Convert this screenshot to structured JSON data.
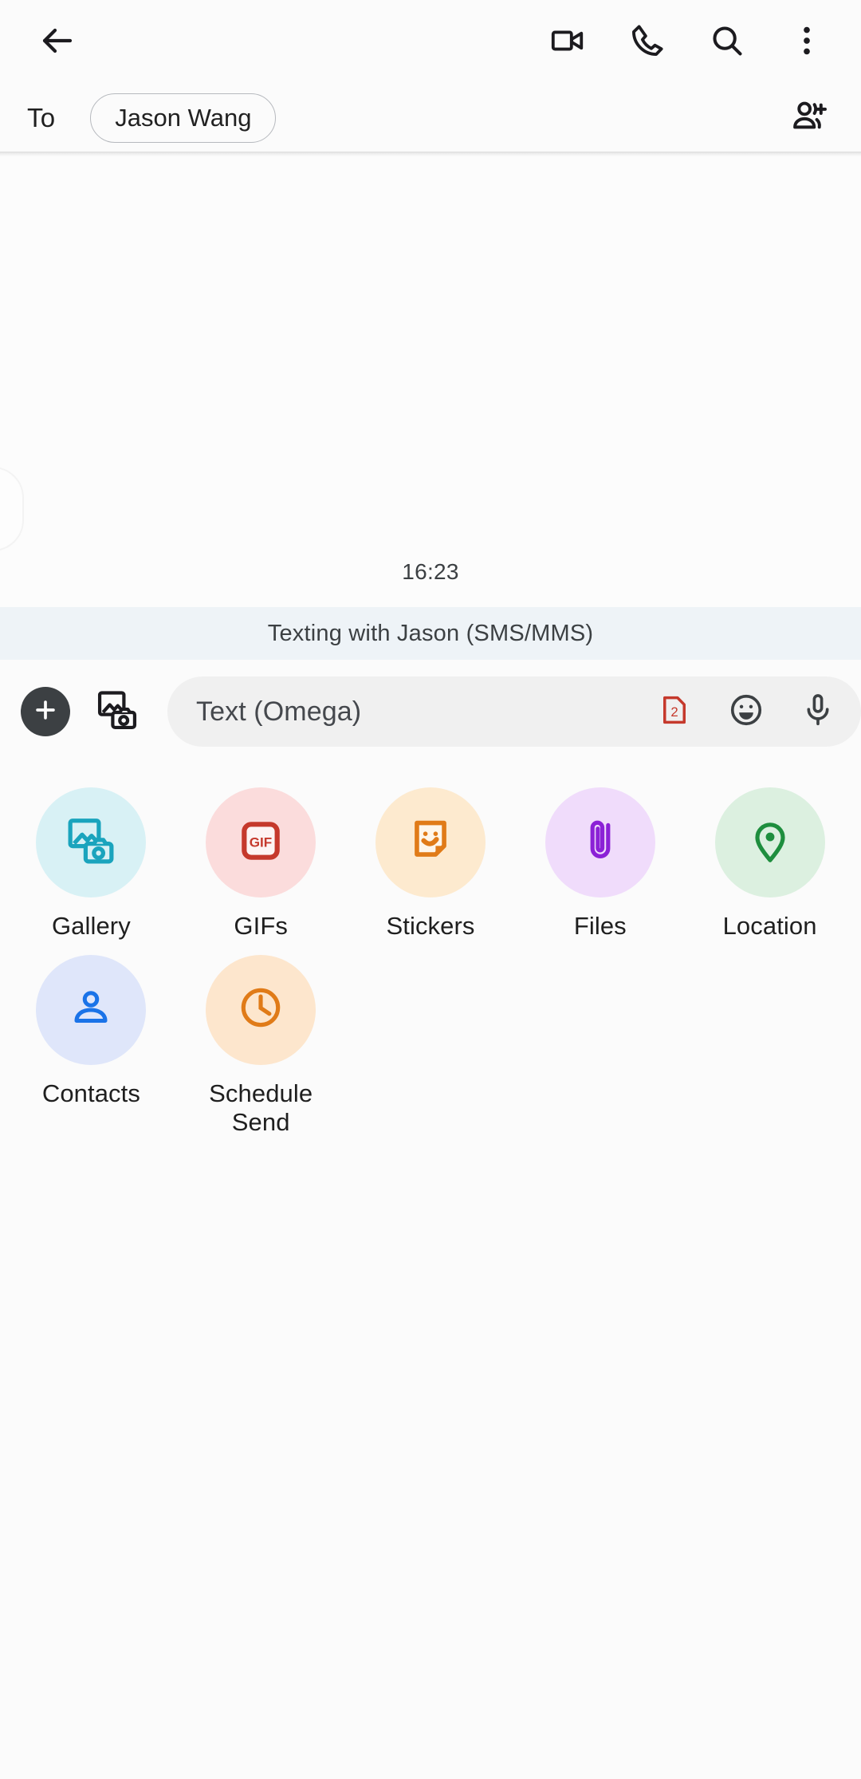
{
  "appbar": {
    "back_icon": "back-arrow-icon",
    "actions": [
      {
        "name": "video-call-button",
        "icon": "video-camera-icon",
        "label": "Video call"
      },
      {
        "name": "voice-call-button",
        "icon": "phone-icon",
        "label": "Call"
      },
      {
        "name": "search-button",
        "icon": "search-icon",
        "label": "Search"
      },
      {
        "name": "overflow-menu-button",
        "icon": "three-dot-menu-icon",
        "label": "More options"
      }
    ]
  },
  "recipient": {
    "to_label": "To",
    "chips": [
      {
        "name": "Jason Wang"
      }
    ],
    "add_person_icon": "person-add-icon",
    "add_person_label": "Add people"
  },
  "conversation": {
    "timestamp": "16:23"
  },
  "banner": {
    "text": "Texting with Jason (SMS/MMS)",
    "background": "#eef3f7"
  },
  "compose": {
    "plus_icon": "plus-icon",
    "gallery_quick_icon": "gallery-camera-icon",
    "placeholder": "Text (Omega)",
    "input_value": "",
    "actions": [
      {
        "name": "sim-select-button",
        "icon": "sim-card-icon",
        "badge": "2",
        "color": "#c5392c"
      },
      {
        "name": "emoji-button",
        "icon": "emoji-smiley-icon",
        "color": "#3c4043"
      },
      {
        "name": "voice-record-button",
        "icon": "microphone-icon",
        "color": "#3c4043"
      }
    ]
  },
  "attachments": [
    {
      "label": "Gallery",
      "icon": "gallery-camera-icon",
      "circle": "#d8f1f5",
      "accent": "#1aa4bd"
    },
    {
      "label": "GIFs",
      "icon": "gif-icon",
      "circle": "#fbdcdc",
      "accent": "#c5392c"
    },
    {
      "label": "Stickers",
      "icon": "sticker-face-icon",
      "circle": "#fdeacf",
      "accent": "#e07b18"
    },
    {
      "label": "Files",
      "icon": "paperclip-icon",
      "circle": "#f0dcfb",
      "accent": "#8b21d6"
    },
    {
      "label": "Location",
      "icon": "location-pin-icon",
      "circle": "#dcf0e0",
      "accent": "#1e8e3e"
    },
    {
      "label": "Contacts",
      "icon": "person-icon",
      "circle": "#dfe6fa",
      "accent": "#1a73e8"
    },
    {
      "label": "Schedule Send",
      "icon": "clock-icon",
      "circle": "#fde6cd",
      "accent": "#e07b18"
    }
  ]
}
